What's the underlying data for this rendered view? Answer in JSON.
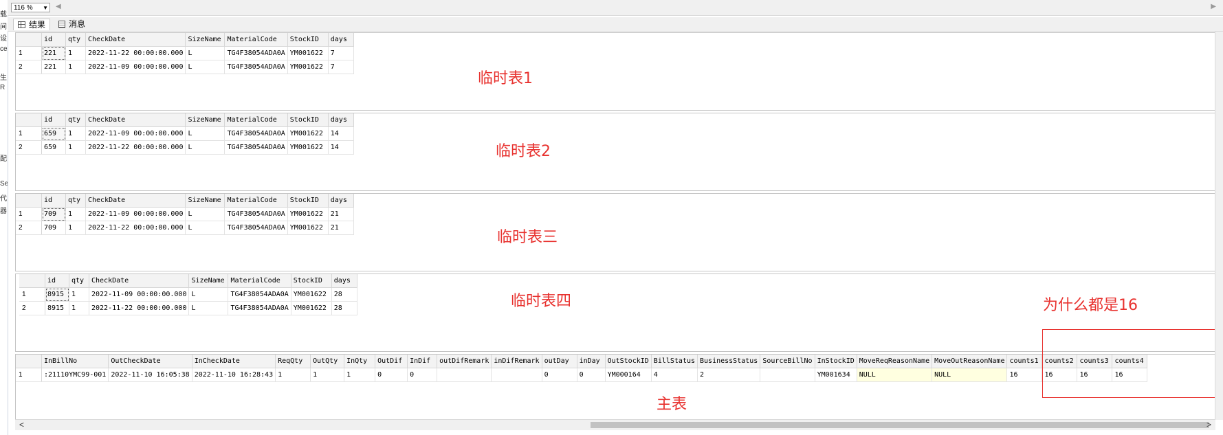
{
  "left_strip": [
    "载",
    "间",
    "设",
    "ce",
    "",
    "生",
    "R",
    "",
    "",
    "",
    "",
    "配",
    "",
    "Se",
    "代",
    "器"
  ],
  "zoom": {
    "value": "116 %"
  },
  "tabs": [
    {
      "label": "结果"
    },
    {
      "label": "消息"
    }
  ],
  "temp_columns": [
    "id",
    "qty",
    "CheckDate",
    "SizeName",
    "MaterialCode",
    "StockID",
    "days"
  ],
  "tables": [
    {
      "rows": [
        {
          "n": "1",
          "cells": [
            "221",
            "1",
            "2022-11-22 00:00:00.000",
            "L",
            "TG4F38054ADA0A",
            "YM001622",
            "7"
          ]
        },
        {
          "n": "2",
          "cells": [
            "221",
            "1",
            "2022-11-09 00:00:00.000",
            "L",
            "TG4F38054ADA0A",
            "YM001622",
            "7"
          ]
        }
      ]
    },
    {
      "rows": [
        {
          "n": "1",
          "cells": [
            "659",
            "1",
            "2022-11-09 00:00:00.000",
            "L",
            "TG4F38054ADA0A",
            "YM001622",
            "14"
          ]
        },
        {
          "n": "2",
          "cells": [
            "659",
            "1",
            "2022-11-22 00:00:00.000",
            "L",
            "TG4F38054ADA0A",
            "YM001622",
            "14"
          ]
        }
      ]
    },
    {
      "rows": [
        {
          "n": "1",
          "cells": [
            "709",
            "1",
            "2022-11-09 00:00:00.000",
            "L",
            "TG4F38054ADA0A",
            "YM001622",
            "21"
          ]
        },
        {
          "n": "2",
          "cells": [
            "709",
            "1",
            "2022-11-22 00:00:00.000",
            "L",
            "TG4F38054ADA0A",
            "YM001622",
            "21"
          ]
        }
      ]
    },
    {
      "rows": [
        {
          "n": "1",
          "cells": [
            "8915",
            "1",
            "2022-11-09 00:00:00.000",
            "L",
            "TG4F38054ADA0A",
            "YM001622",
            "28"
          ]
        },
        {
          "n": "2",
          "cells": [
            "8915",
            "1",
            "2022-11-22 00:00:00.000",
            "L",
            "TG4F38054ADA0A",
            "YM001622",
            "28"
          ]
        }
      ]
    }
  ],
  "main_table": {
    "columns": [
      "InBillNo",
      "OutCheckDate",
      "InCheckDate",
      "ReqQty",
      "OutQty",
      "InQty",
      "OutDif",
      "InDif",
      "outDifRemark",
      "inDifRemark",
      "outDay",
      "inDay",
      "OutStockID",
      "BillStatus",
      "BusinessStatus",
      "SourceBillNo",
      "InStockID",
      "MoveReqReasonName",
      "MoveOutReasonName",
      "counts1",
      "counts2",
      "counts3",
      "counts4"
    ],
    "rows": [
      {
        "n": "1",
        "cells": [
          ":21110YMC99-001",
          "2022-11-10 16:05:38",
          "2022-11-10 16:28:43",
          "1",
          "1",
          "1",
          "0",
          "0",
          "",
          "",
          "0",
          "0",
          "YM000164",
          "4",
          "2",
          "",
          "YM001634",
          "NULL",
          "NULL",
          "16",
          "16",
          "16",
          "16"
        ]
      }
    ]
  },
  "annotations": {
    "t1": "临时表1",
    "t2": "临时表2",
    "t3": "临时表三",
    "t4": "临时表四",
    "question": "为什么都是16",
    "main": "主表"
  }
}
